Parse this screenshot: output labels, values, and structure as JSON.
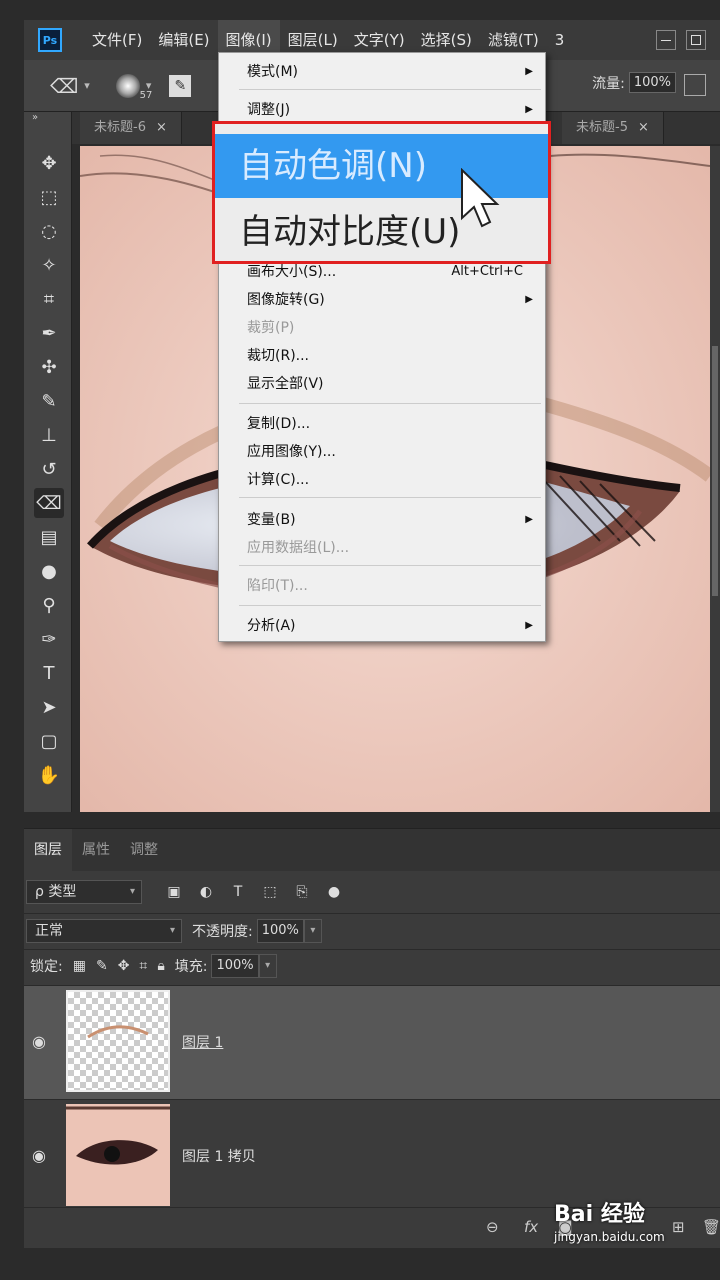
{
  "app": {
    "logo": "Ps"
  },
  "menubar": {
    "items": [
      "文件(F)",
      "编辑(E)",
      "图像(I)",
      "图层(L)",
      "文字(Y)",
      "选择(S)",
      "滤镜(T)",
      "3"
    ]
  },
  "options": {
    "brush_size": "57",
    "flow_label": "流量:",
    "flow_value": "100%"
  },
  "tabs": [
    {
      "label": "未标题-6",
      "close": "×"
    },
    {
      "label": "未标题-5",
      "close": "×"
    }
  ],
  "image_menu": {
    "items": [
      {
        "label": "模式(M)",
        "submenu": true
      },
      {
        "label": "调整(J)",
        "submenu": true
      },
      {
        "label": "自动色调(N)",
        "highlighted": true
      },
      {
        "label": "自动对比度(U)"
      },
      {
        "label": "画布大小(S)...",
        "shortcut": "Alt+Ctrl+C"
      },
      {
        "label": "图像旋转(G)",
        "submenu": true
      },
      {
        "label": "裁剪(P)",
        "disabled": true
      },
      {
        "label": "裁切(R)..."
      },
      {
        "label": "显示全部(V)"
      },
      {
        "label": "复制(D)..."
      },
      {
        "label": "应用图像(Y)..."
      },
      {
        "label": "计算(C)..."
      },
      {
        "label": "变量(B)",
        "submenu": true
      },
      {
        "label": "应用数据组(L)...",
        "disabled": true
      },
      {
        "label": "陷印(T)...",
        "disabled": true
      },
      {
        "label": "分析(A)",
        "submenu": true
      }
    ]
  },
  "layers_panel": {
    "tabs": [
      "图层",
      "属性",
      "调整"
    ],
    "filter_kind": "ρ 类型",
    "blend_mode": "正常",
    "opacity_label": "不透明度:",
    "opacity_value": "100%",
    "lock_label": "锁定:",
    "fill_label": "填充:",
    "fill_value": "100%",
    "layers": [
      {
        "name": "图层 1",
        "selected": true
      },
      {
        "name": "图层 1 拷贝",
        "selected": false
      }
    ],
    "footer": [
      "⊖",
      "fx"
    ]
  },
  "watermark": {
    "logo": "Bai 经验",
    "url": "jingyan.baidu.com"
  },
  "colors": {
    "highlight": "#3399f0",
    "callout": "#e02020"
  }
}
